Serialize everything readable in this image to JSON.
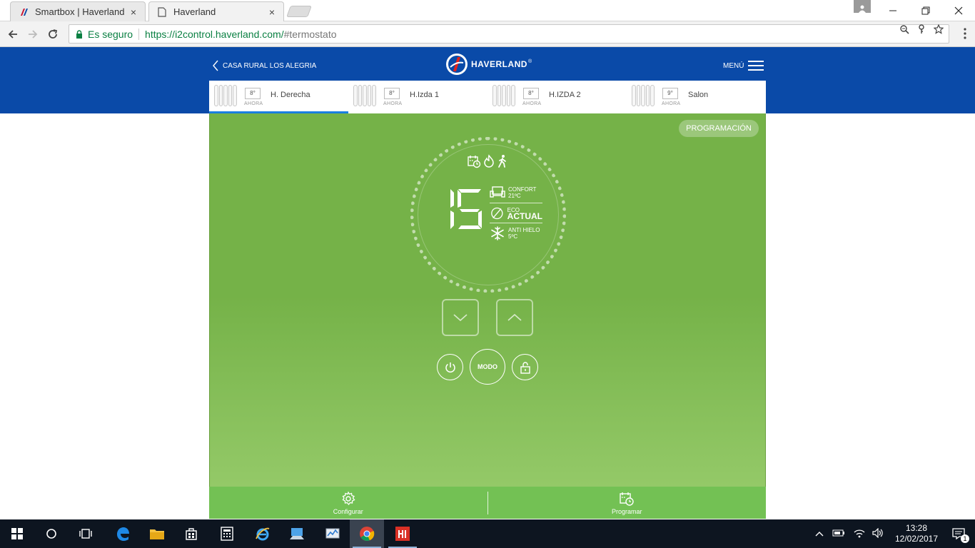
{
  "browser": {
    "tabs": [
      {
        "title": "Smartbox | Haverland",
        "close": "×"
      },
      {
        "title": "Haverland",
        "close": "×"
      }
    ],
    "secure_label": "Es seguro",
    "url_host": "https://i2control.haverland.com/",
    "url_path": "#termostato"
  },
  "header": {
    "back_label": "CASA RURAL LOS ALEGRIA",
    "brand": "HAVERLAND",
    "brand_mark": "®",
    "menu_label": "MENÚ"
  },
  "devices": [
    {
      "name": "H. Derecha",
      "temp": "8°",
      "now": "AHORA",
      "active": true
    },
    {
      "name": "H.Izda 1",
      "temp": "8°",
      "now": "AHORA",
      "active": false
    },
    {
      "name": "H.IZDA 2",
      "temp": "8°",
      "now": "AHORA",
      "active": false
    },
    {
      "name": "Salon",
      "temp": "9°",
      "now": "AHORA",
      "active": false
    }
  ],
  "thermostat": {
    "programming_label": "PROGRAMACIÓN",
    "display_digit": "15",
    "modes": {
      "confort_label": "CONFORT",
      "confort_temp": "21ºC",
      "eco_label": "ECO",
      "eco_status": "ACTUAL",
      "antihielo_label": "ANTI HIELO",
      "antihielo_temp": "5ºC"
    },
    "modo_label": "MODO",
    "status_icons": [
      "calendar-clock-icon",
      "flame-icon",
      "walking-person-icon"
    ]
  },
  "footer": {
    "configure_label": "Configurar",
    "program_label": "Programar"
  },
  "taskbar": {
    "time": "13:28",
    "date": "12/02/2017",
    "notification_count": "1"
  },
  "colors": {
    "header_blue": "#0a4aa8",
    "panel_green": "#75b248",
    "footer_green": "#73c154",
    "active_tab_underline": "#1a7fe0"
  }
}
